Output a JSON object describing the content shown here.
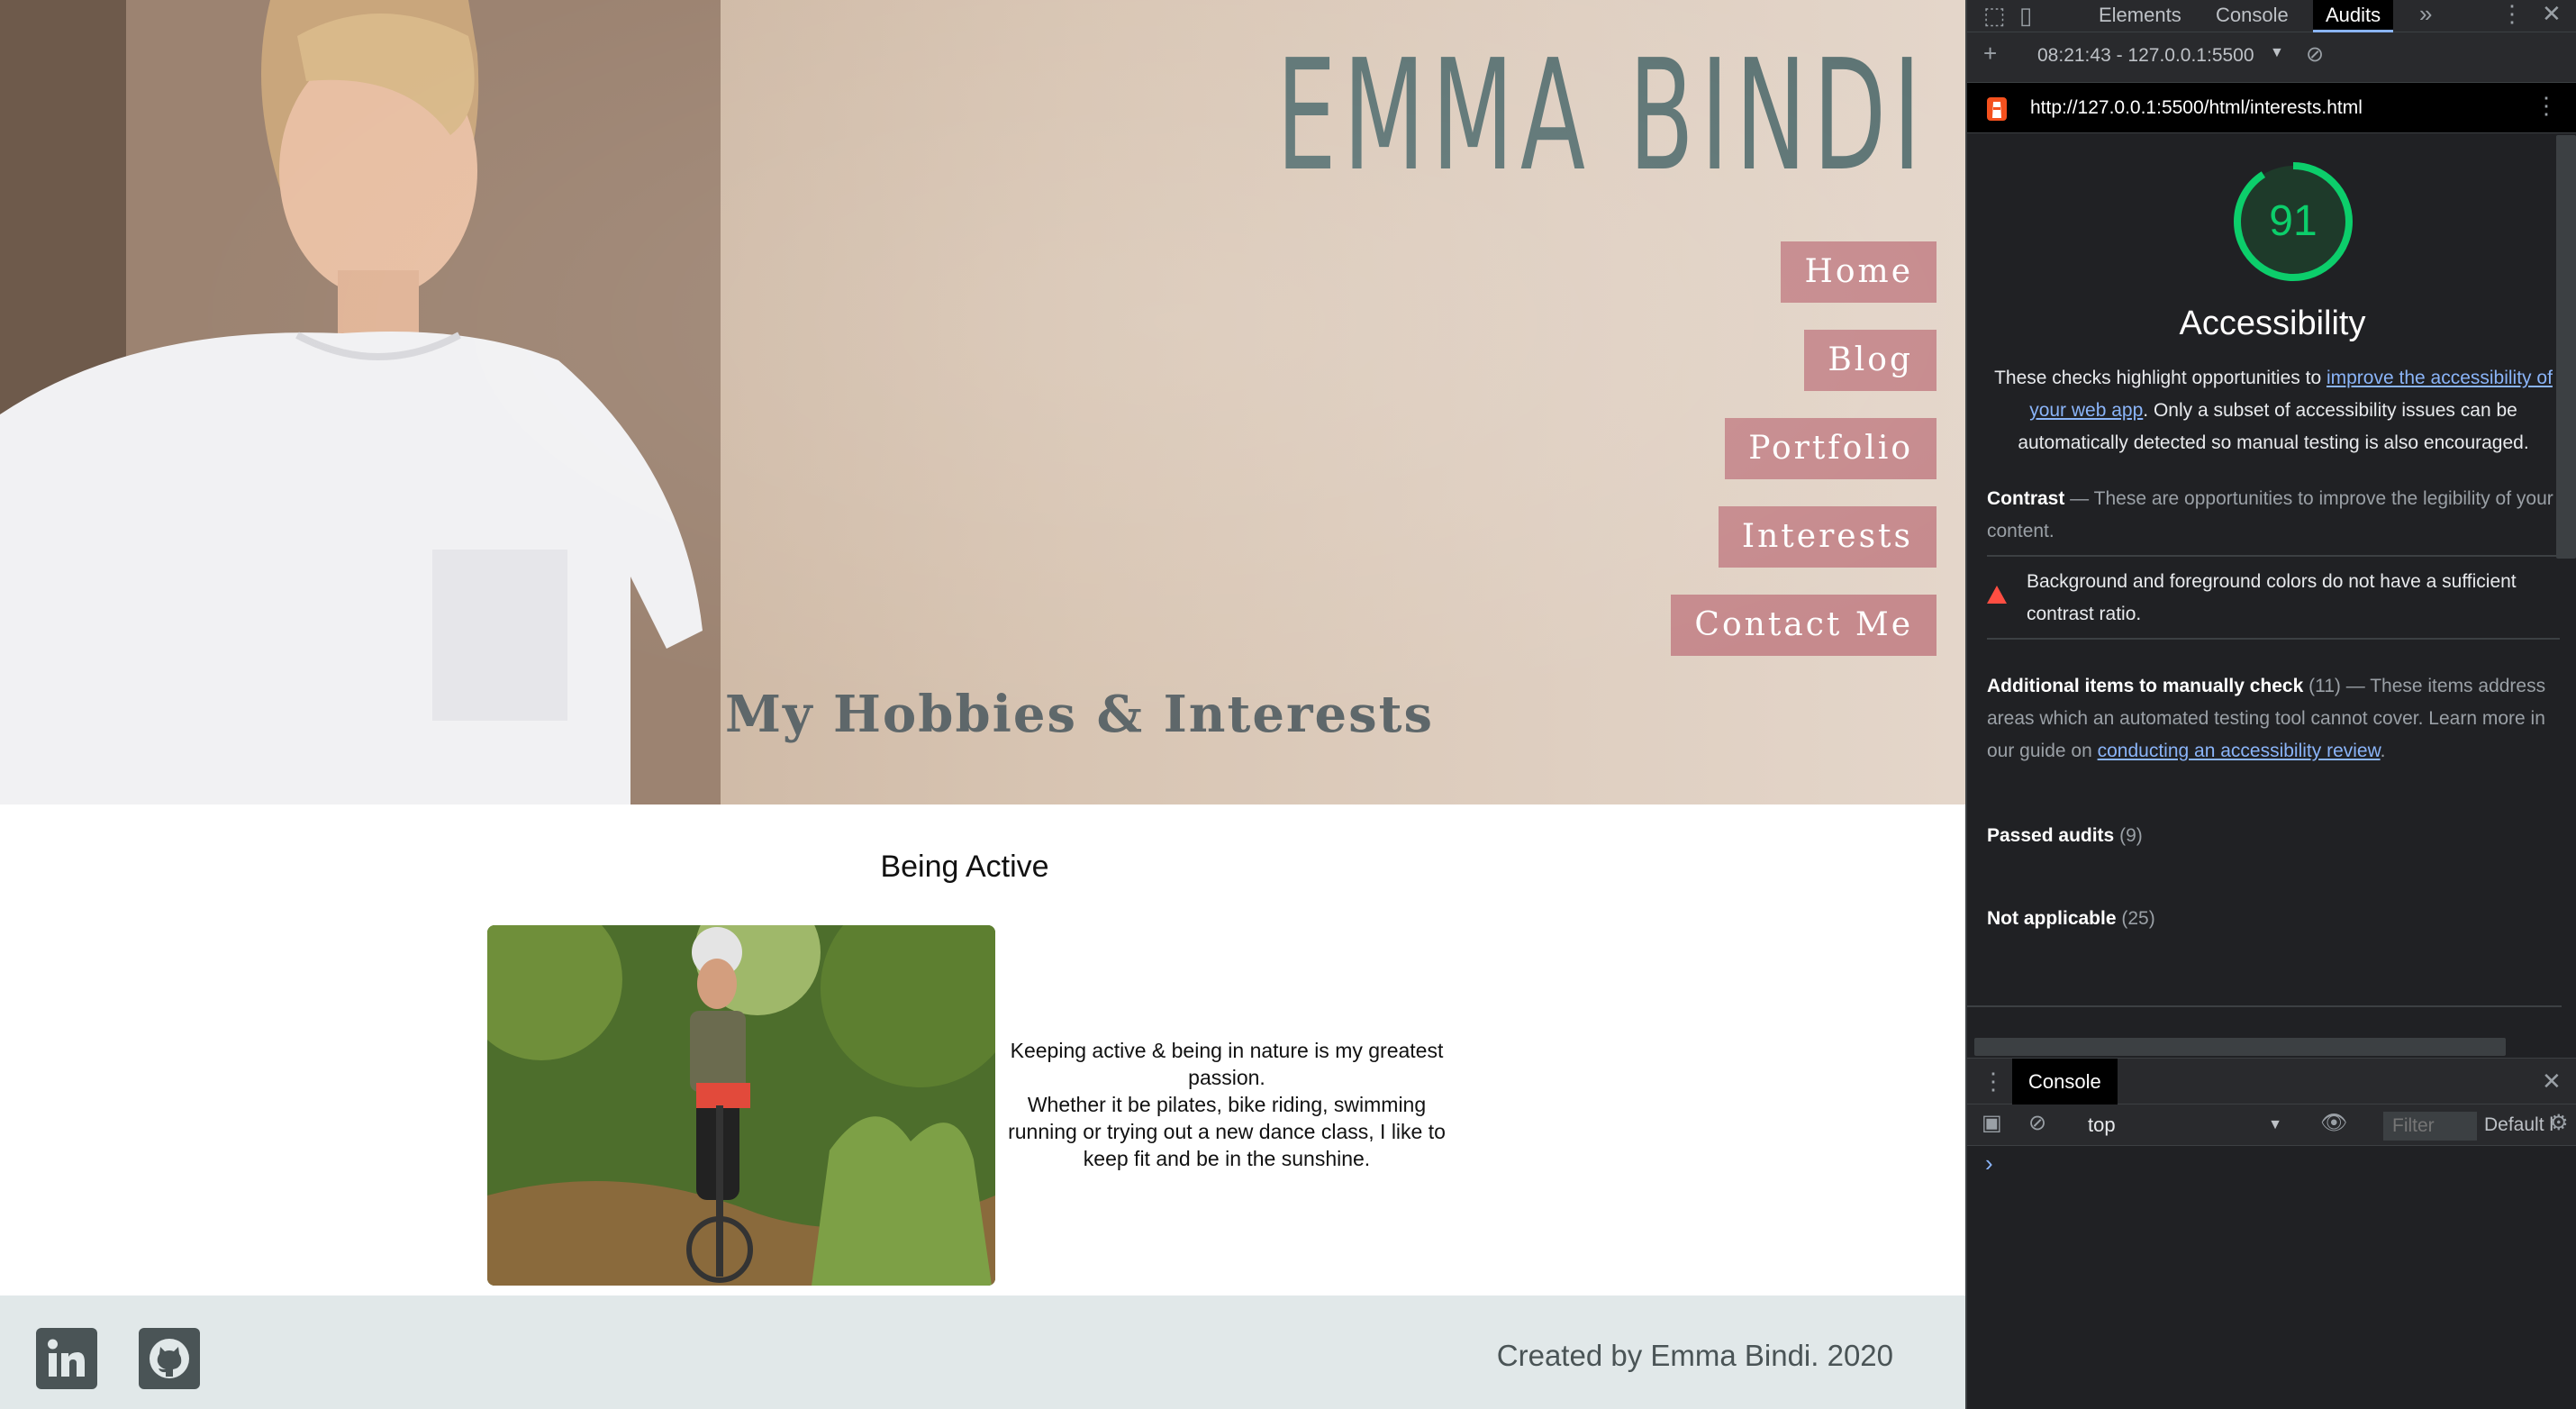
{
  "site": {
    "title": "EMMA BINDI",
    "nav": [
      "Home",
      "Blog",
      "Portfolio",
      "Interests",
      "Contact Me"
    ],
    "hero_subtitle": "My Hobbies & Interests",
    "section": {
      "heading": "Being Active",
      "text_line1": "Keeping active & being in nature is my greatest passion.",
      "text_line2": "Whether it be pilates, bike riding, swimming running or trying out a new dance class, I like to keep fit and be in the sunshine."
    },
    "footer": {
      "credit": "Created by Emma Bindi. 2020",
      "social": [
        "linkedin-icon",
        "github-icon"
      ]
    },
    "colors": {
      "title": "#5d7474",
      "nav_bg": "#c68a8d",
      "footer_bg": "#e1e8e9"
    }
  },
  "devtools": {
    "tabs": [
      "Elements",
      "Console",
      "Audits"
    ],
    "active_tab": "Audits",
    "report_label": "08:21:43 - 127.0.0.1:5500",
    "url": "http://127.0.0.1:5500/html/interests.html",
    "score": "91",
    "score_fraction": 0.91,
    "category": "Accessibility",
    "desc_pre": "These checks highlight opportunities to ",
    "desc_link": "improve the accessibility of your web app",
    "desc_post": ". Only a subset of accessibility issues can be automatically detected so manual testing is also encouraged.",
    "contrast_title": "Contrast",
    "contrast_desc": "These are opportunities to improve the legibility of your content.",
    "contrast_warning": "Background and foreground colors do not have a sufficient contrast ratio.",
    "manual_title": "Additional items to manually check",
    "manual_count": "(11)",
    "manual_desc": "These items address areas which an automated testing tool cannot cover. Learn more in our guide on ",
    "manual_link": "conducting an accessibility review",
    "passed_title": "Passed audits",
    "passed_count": "(9)",
    "na_title": "Not applicable",
    "na_count": "(25)",
    "drawer_tab": "Console",
    "context": "top",
    "filter_placeholder": "Filter",
    "levels": "Default levels",
    "score_color": "#0cce6b"
  }
}
